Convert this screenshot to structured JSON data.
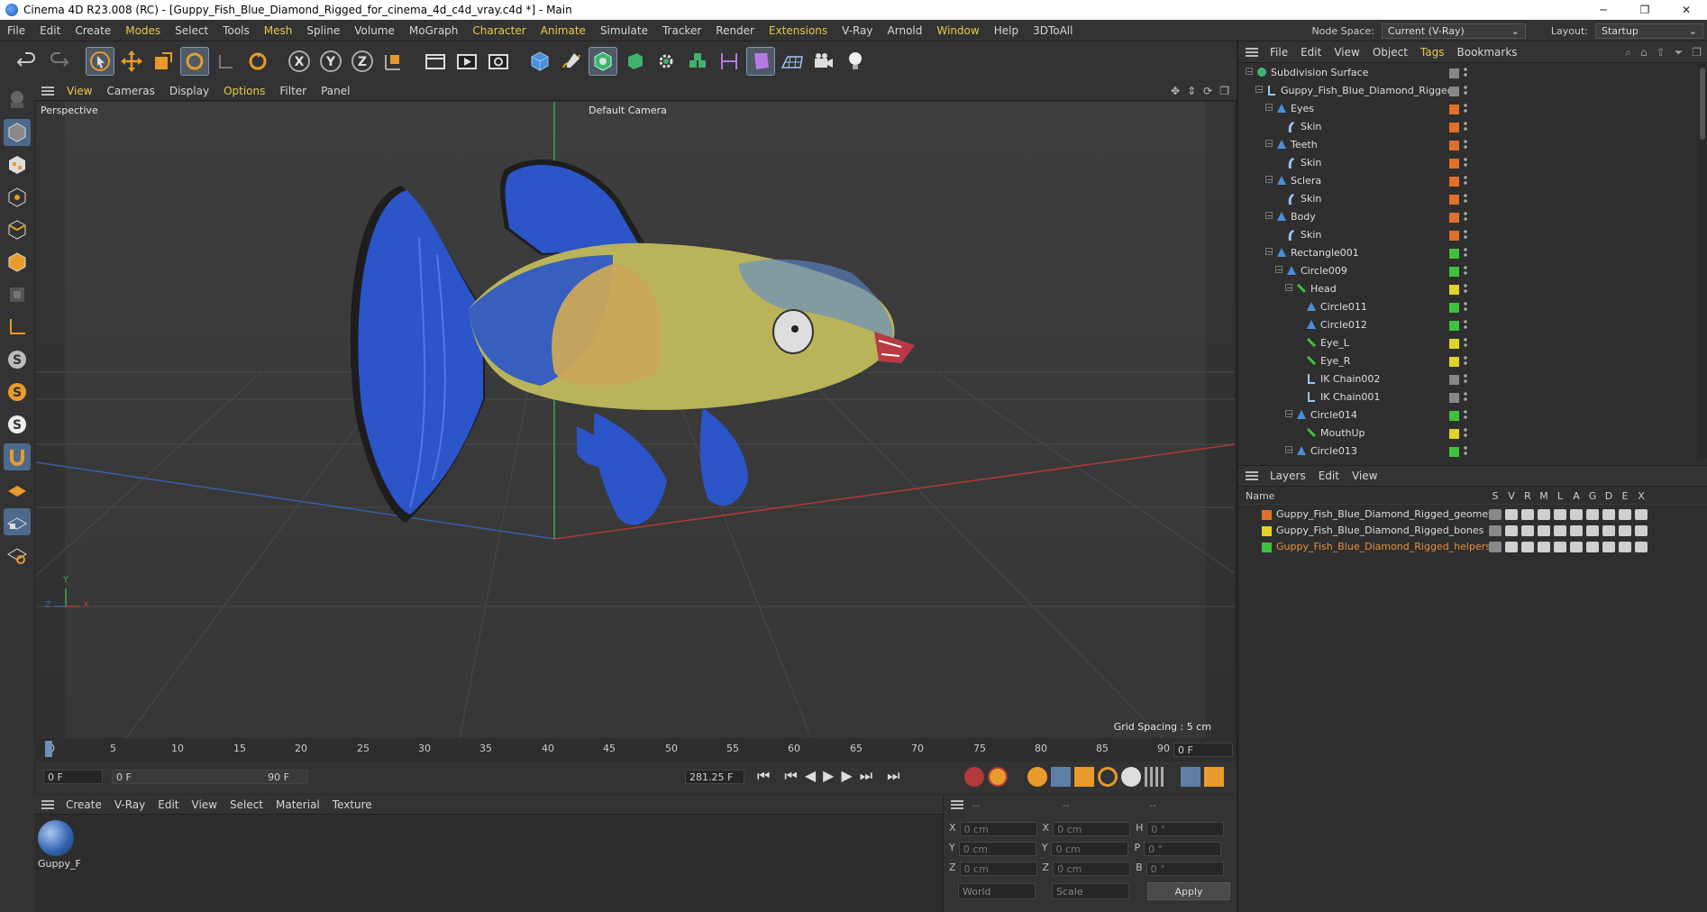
{
  "window": {
    "title": "Cinema 4D R23.008 (RC) - [Guppy_Fish_Blue_Diamond_Rigged_for_cinema_4d_c4d_vray.c4d *] - Main",
    "controls": [
      "─",
      "❐",
      "✕"
    ]
  },
  "menubar": {
    "items": [
      "File",
      "Edit",
      "Create",
      "Modes",
      "Select",
      "Tools",
      "Mesh",
      "Spline",
      "Volume",
      "MoGraph",
      "Character",
      "Animate",
      "Simulate",
      "Tracker",
      "Render",
      "Extensions",
      "V-Ray",
      "Arnold",
      "Window",
      "Help",
      "3DToAll"
    ],
    "node_space_label": "Node Space:",
    "node_space_value": "Current (V-Ray)",
    "layout_label": "Layout:",
    "layout_value": "Startup"
  },
  "toolbar": {
    "icons": [
      "undo-icon",
      "redo-icon",
      "select-arrow-icon",
      "move-icon",
      "scale-icon",
      "rotate-icon",
      "null-icon",
      "recent-icon",
      "x-axis-icon",
      "y-axis-icon",
      "z-axis-icon",
      "coordinate-system-icon",
      "render-view-icon",
      "render-picture-viewer-icon",
      "render-settings-icon",
      "cube-icon",
      "pen-icon",
      "subdivision-icon",
      "extrude-icon",
      "mograph-cloner-icon",
      "volume-icon",
      "spline-icon",
      "deformer-icon",
      "floor-icon",
      "camera-icon",
      "light-icon"
    ]
  },
  "viewport": {
    "menu": [
      "View",
      "Cameras",
      "Display",
      "Options",
      "Filter",
      "Panel"
    ],
    "label": "Perspective",
    "camera": "Default Camera",
    "grid_spacing": "Grid Spacing : 5 cm",
    "axis_labels": {
      "y": "Y",
      "z": "Z",
      "x": "X"
    },
    "colors": {
      "fish_blue": "#2b55c9",
      "fish_body": "#b9b35a",
      "grid_x": "#b23a3a",
      "grid_z": "#3a5fa8",
      "grid_y": "#3aa84f"
    }
  },
  "timeline": {
    "ticks": [
      "0",
      "5",
      "10",
      "15",
      "20",
      "25",
      "30",
      "35",
      "40",
      "45",
      "50",
      "55",
      "60",
      "65",
      "70",
      "75",
      "80",
      "85",
      "90"
    ],
    "current_frame": "0 F",
    "start_field": "0 F",
    "range_start": "0 F",
    "range_end": "90 F",
    "fps_field": "281.25 F"
  },
  "material_manager": {
    "menu": [
      "Create",
      "V-Ray",
      "Edit",
      "View",
      "Select",
      "Material",
      "Texture"
    ],
    "material_name": "Guppy_F"
  },
  "coordinates": {
    "rows": [
      {
        "a": "X",
        "av": "0 cm",
        "b": "X",
        "bv": "0 cm",
        "c": "H",
        "cv": "0 °"
      },
      {
        "a": "Y",
        "av": "0 cm",
        "b": "Y",
        "bv": "0 cm",
        "c": "P",
        "cv": "0 °"
      },
      {
        "a": "Z",
        "av": "0 cm",
        "b": "Z",
        "bv": "0 cm",
        "c": "B",
        "cv": "0 °"
      }
    ],
    "header": [
      "--",
      "--",
      "--"
    ],
    "world": "World",
    "scale": "Scale",
    "apply": "Apply"
  },
  "object_manager": {
    "menu": [
      "File",
      "Edit",
      "View",
      "Object",
      "Tags",
      "Bookmarks"
    ],
    "rows": [
      {
        "name": "Subdivision Surface",
        "color": "#888888",
        "icon": "subdivision-icon"
      },
      {
        "name": "Guppy_Fish_Blue_Diamond_Rigged",
        "color": "#888888",
        "icon": "null-icon"
      },
      {
        "name": "Eyes",
        "color": "#e0702a",
        "icon": "polygon-icon"
      },
      {
        "name": "Skin",
        "color": "#e0702a",
        "icon": "skin-icon"
      },
      {
        "name": "Teeth",
        "color": "#e0702a",
        "icon": "polygon-icon"
      },
      {
        "name": "Skin",
        "color": "#e0702a",
        "icon": "skin-icon"
      },
      {
        "name": "Sclera",
        "color": "#e0702a",
        "icon": "polygon-icon"
      },
      {
        "name": "Skin",
        "color": "#e0702a",
        "icon": "skin-icon"
      },
      {
        "name": "Body",
        "color": "#e0702a",
        "icon": "polygon-icon"
      },
      {
        "name": "Skin",
        "color": "#e0702a",
        "icon": "skin-icon"
      },
      {
        "name": "Rectangle001",
        "color": "#3fc13f",
        "icon": "spline-icon"
      },
      {
        "name": "Circle009",
        "color": "#3fc13f",
        "icon": "spline-icon"
      },
      {
        "name": "Head",
        "color": "#e0d22a",
        "icon": "joint-icon"
      },
      {
        "name": "Circle011",
        "color": "#3fc13f",
        "icon": "spline-icon"
      },
      {
        "name": "Circle012",
        "color": "#3fc13f",
        "icon": "spline-icon"
      },
      {
        "name": "Eye_L",
        "color": "#e0d22a",
        "icon": "joint-icon"
      },
      {
        "name": "Eye_R",
        "color": "#e0d22a",
        "icon": "joint-icon"
      },
      {
        "name": "IK Chain002",
        "color": "#888888",
        "icon": "ik-icon"
      },
      {
        "name": "IK Chain001",
        "color": "#888888",
        "icon": "ik-icon"
      },
      {
        "name": "Circle014",
        "color": "#3fc13f",
        "icon": "spline-icon"
      },
      {
        "name": "MouthUp",
        "color": "#e0d22a",
        "icon": "joint-icon"
      },
      {
        "name": "Circle013",
        "color": "#3fc13f",
        "icon": "spline-icon"
      }
    ]
  },
  "layer_manager": {
    "menu": [
      "Layers",
      "Edit",
      "View"
    ],
    "name_header": "Name",
    "col_headers": [
      "S",
      "V",
      "R",
      "M",
      "L",
      "A",
      "G",
      "D",
      "E",
      "X"
    ],
    "layers": [
      {
        "name": "Guppy_Fish_Blue_Diamond_Rigged_geometru",
        "color": "#e0702a"
      },
      {
        "name": "Guppy_Fish_Blue_Diamond_Rigged_bones",
        "color": "#e0d22a"
      },
      {
        "name": "Guppy_Fish_Blue_Diamond_Rigged_helpers",
        "color": "#3fc13f"
      }
    ]
  }
}
